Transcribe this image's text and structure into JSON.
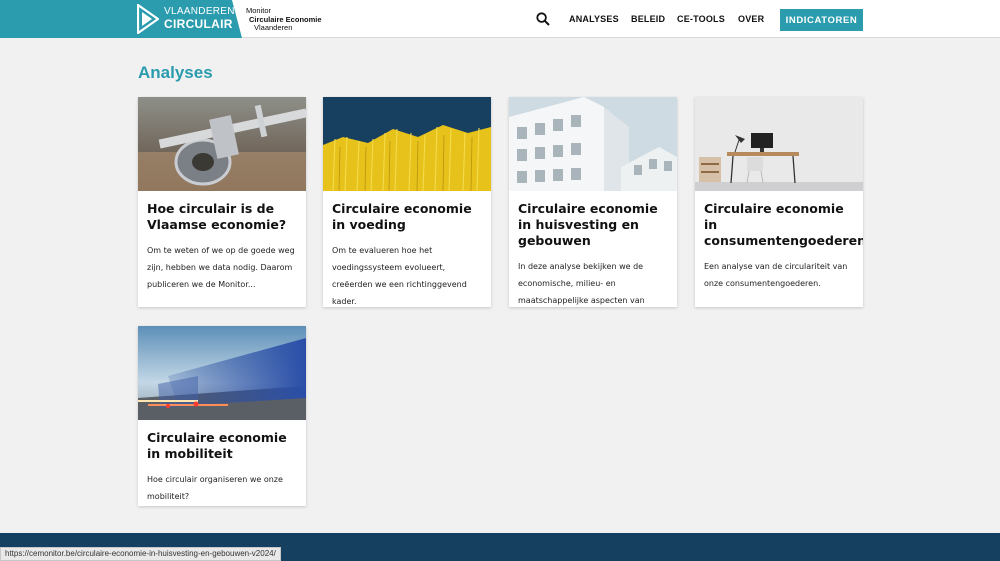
{
  "header": {
    "logo_line1": "VLAANDEREN",
    "logo_line2": "CIRCULAIR",
    "monitor_line1": "Monitor",
    "monitor_line2": "Circulaire Economie",
    "monitor_line3": "Vlaanderen",
    "nav": [
      "ANALYSES",
      "BELEID",
      "CE-TOOLS",
      "OVER"
    ],
    "cta": "INDICATOREN",
    "brand_color": "#2a9cae"
  },
  "page_title": "Analyses",
  "cards": [
    {
      "title": "Hoe circulair is de Vlaamse economie?",
      "description": "Om te weten of we op de goede weg zijn, hebben we data nodig. Daarom publiceren we de Monitor...",
      "image": "caliper-measuring-flange"
    },
    {
      "title": "Circulaire economie in voeding",
      "description": "Om te evalueren hoe het voedingssysteem evolueert, creëerden we een richtinggevend kader.",
      "image": "yellow-pasta-sticks"
    },
    {
      "title": "Circulaire economie in huisvesting en gebouwen",
      "description": "In deze analyse bekijken we de economische, milieu- en maatschappelijke aspecten van onze...",
      "image": "white-building-facade"
    },
    {
      "title": "Circulaire economie in consumentengoederen",
      "description": "Een analyse van de circulariteit van onze consumentengoederen.",
      "image": "home-office-desk"
    },
    {
      "title": "Circulaire economie in mobiliteit",
      "description": "Hoe circulair organiseren we onze mobiliteit?",
      "image": "truck-motion-blur"
    }
  ],
  "status_url": "https://cemonitor.be/circulaire-economie-in-huisvesting-en-gebouwen-v2024/"
}
